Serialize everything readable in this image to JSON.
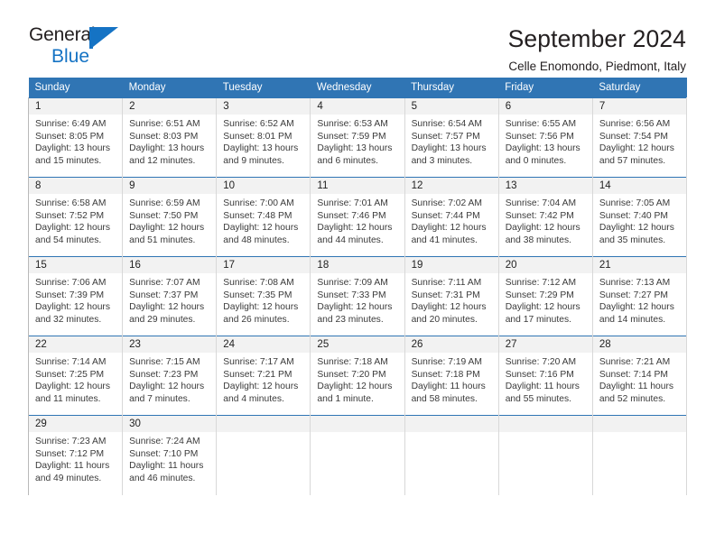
{
  "logo": {
    "word1": "General",
    "word2": "Blue",
    "flag_icon": "flag-icon",
    "color_dark": "#231f20",
    "color_blue": "#1573c4"
  },
  "header": {
    "title": "September 2024",
    "subtitle": "Celle Enomondo, Piedmont, Italy"
  },
  "theme": {
    "header_blue": "#3075b4",
    "daynum_band": "#f2f2f2",
    "text": "#3a3a3a"
  },
  "calendar": {
    "weekday_headers": [
      "Sunday",
      "Monday",
      "Tuesday",
      "Wednesday",
      "Thursday",
      "Friday",
      "Saturday"
    ],
    "weeks": [
      [
        {
          "day": "1",
          "sunrise": "Sunrise: 6:49 AM",
          "sunset": "Sunset: 8:05 PM",
          "daylight": "Daylight: 13 hours and 15 minutes."
        },
        {
          "day": "2",
          "sunrise": "Sunrise: 6:51 AM",
          "sunset": "Sunset: 8:03 PM",
          "daylight": "Daylight: 13 hours and 12 minutes."
        },
        {
          "day": "3",
          "sunrise": "Sunrise: 6:52 AM",
          "sunset": "Sunset: 8:01 PM",
          "daylight": "Daylight: 13 hours and 9 minutes."
        },
        {
          "day": "4",
          "sunrise": "Sunrise: 6:53 AM",
          "sunset": "Sunset: 7:59 PM",
          "daylight": "Daylight: 13 hours and 6 minutes."
        },
        {
          "day": "5",
          "sunrise": "Sunrise: 6:54 AM",
          "sunset": "Sunset: 7:57 PM",
          "daylight": "Daylight: 13 hours and 3 minutes."
        },
        {
          "day": "6",
          "sunrise": "Sunrise: 6:55 AM",
          "sunset": "Sunset: 7:56 PM",
          "daylight": "Daylight: 13 hours and 0 minutes."
        },
        {
          "day": "7",
          "sunrise": "Sunrise: 6:56 AM",
          "sunset": "Sunset: 7:54 PM",
          "daylight": "Daylight: 12 hours and 57 minutes."
        }
      ],
      [
        {
          "day": "8",
          "sunrise": "Sunrise: 6:58 AM",
          "sunset": "Sunset: 7:52 PM",
          "daylight": "Daylight: 12 hours and 54 minutes."
        },
        {
          "day": "9",
          "sunrise": "Sunrise: 6:59 AM",
          "sunset": "Sunset: 7:50 PM",
          "daylight": "Daylight: 12 hours and 51 minutes."
        },
        {
          "day": "10",
          "sunrise": "Sunrise: 7:00 AM",
          "sunset": "Sunset: 7:48 PM",
          "daylight": "Daylight: 12 hours and 48 minutes."
        },
        {
          "day": "11",
          "sunrise": "Sunrise: 7:01 AM",
          "sunset": "Sunset: 7:46 PM",
          "daylight": "Daylight: 12 hours and 44 minutes."
        },
        {
          "day": "12",
          "sunrise": "Sunrise: 7:02 AM",
          "sunset": "Sunset: 7:44 PM",
          "daylight": "Daylight: 12 hours and 41 minutes."
        },
        {
          "day": "13",
          "sunrise": "Sunrise: 7:04 AM",
          "sunset": "Sunset: 7:42 PM",
          "daylight": "Daylight: 12 hours and 38 minutes."
        },
        {
          "day": "14",
          "sunrise": "Sunrise: 7:05 AM",
          "sunset": "Sunset: 7:40 PM",
          "daylight": "Daylight: 12 hours and 35 minutes."
        }
      ],
      [
        {
          "day": "15",
          "sunrise": "Sunrise: 7:06 AM",
          "sunset": "Sunset: 7:39 PM",
          "daylight": "Daylight: 12 hours and 32 minutes."
        },
        {
          "day": "16",
          "sunrise": "Sunrise: 7:07 AM",
          "sunset": "Sunset: 7:37 PM",
          "daylight": "Daylight: 12 hours and 29 minutes."
        },
        {
          "day": "17",
          "sunrise": "Sunrise: 7:08 AM",
          "sunset": "Sunset: 7:35 PM",
          "daylight": "Daylight: 12 hours and 26 minutes."
        },
        {
          "day": "18",
          "sunrise": "Sunrise: 7:09 AM",
          "sunset": "Sunset: 7:33 PM",
          "daylight": "Daylight: 12 hours and 23 minutes."
        },
        {
          "day": "19",
          "sunrise": "Sunrise: 7:11 AM",
          "sunset": "Sunset: 7:31 PM",
          "daylight": "Daylight: 12 hours and 20 minutes."
        },
        {
          "day": "20",
          "sunrise": "Sunrise: 7:12 AM",
          "sunset": "Sunset: 7:29 PM",
          "daylight": "Daylight: 12 hours and 17 minutes."
        },
        {
          "day": "21",
          "sunrise": "Sunrise: 7:13 AM",
          "sunset": "Sunset: 7:27 PM",
          "daylight": "Daylight: 12 hours and 14 minutes."
        }
      ],
      [
        {
          "day": "22",
          "sunrise": "Sunrise: 7:14 AM",
          "sunset": "Sunset: 7:25 PM",
          "daylight": "Daylight: 12 hours and 11 minutes."
        },
        {
          "day": "23",
          "sunrise": "Sunrise: 7:15 AM",
          "sunset": "Sunset: 7:23 PM",
          "daylight": "Daylight: 12 hours and 7 minutes."
        },
        {
          "day": "24",
          "sunrise": "Sunrise: 7:17 AM",
          "sunset": "Sunset: 7:21 PM",
          "daylight": "Daylight: 12 hours and 4 minutes."
        },
        {
          "day": "25",
          "sunrise": "Sunrise: 7:18 AM",
          "sunset": "Sunset: 7:20 PM",
          "daylight": "Daylight: 12 hours and 1 minute."
        },
        {
          "day": "26",
          "sunrise": "Sunrise: 7:19 AM",
          "sunset": "Sunset: 7:18 PM",
          "daylight": "Daylight: 11 hours and 58 minutes."
        },
        {
          "day": "27",
          "sunrise": "Sunrise: 7:20 AM",
          "sunset": "Sunset: 7:16 PM",
          "daylight": "Daylight: 11 hours and 55 minutes."
        },
        {
          "day": "28",
          "sunrise": "Sunrise: 7:21 AM",
          "sunset": "Sunset: 7:14 PM",
          "daylight": "Daylight: 11 hours and 52 minutes."
        }
      ],
      [
        {
          "day": "29",
          "sunrise": "Sunrise: 7:23 AM",
          "sunset": "Sunset: 7:12 PM",
          "daylight": "Daylight: 11 hours and 49 minutes."
        },
        {
          "day": "30",
          "sunrise": "Sunrise: 7:24 AM",
          "sunset": "Sunset: 7:10 PM",
          "daylight": "Daylight: 11 hours and 46 minutes."
        },
        {
          "day": "",
          "sunrise": "",
          "sunset": "",
          "daylight": ""
        },
        {
          "day": "",
          "sunrise": "",
          "sunset": "",
          "daylight": ""
        },
        {
          "day": "",
          "sunrise": "",
          "sunset": "",
          "daylight": ""
        },
        {
          "day": "",
          "sunrise": "",
          "sunset": "",
          "daylight": ""
        },
        {
          "day": "",
          "sunrise": "",
          "sunset": "",
          "daylight": ""
        }
      ]
    ]
  }
}
